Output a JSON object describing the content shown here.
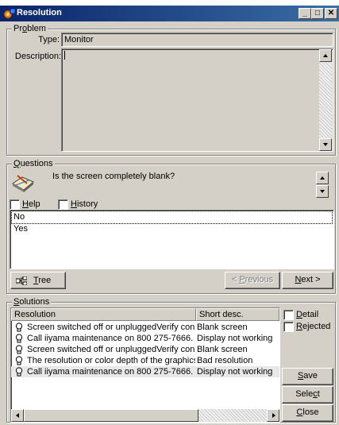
{
  "window": {
    "title": "Resolution",
    "min_glyph": "_",
    "max_glyph": "□",
    "close_glyph": "✕"
  },
  "problem": {
    "group_label_pre": "Pr",
    "group_label_ul": "o",
    "group_label_post": "blem",
    "type_label": "Type:",
    "type_value": "Monitor",
    "description_label": "Description:",
    "description_value": ""
  },
  "questions": {
    "group_label_ul": "Q",
    "group_label_post": "uestions",
    "question_text": "Is the screen completely blank?",
    "help_label_ul": "H",
    "help_label_post": "elp",
    "help_checked": false,
    "history_label_ul": "H",
    "history_label_post": "istory",
    "history_checked": false,
    "answers": [
      "No",
      "Yes"
    ],
    "selected_answer": "No",
    "tree_button_ul": "T",
    "tree_button_post": "ree",
    "previous_button_pre": "< ",
    "previous_button_ul": "P",
    "previous_button_post": "revious",
    "next_button_ul": "N",
    "next_button_post": "ext >"
  },
  "solutions": {
    "group_label_ul": "S",
    "group_label_post": "olutions",
    "columns": [
      "Resolution",
      "Short desc."
    ],
    "rows": [
      {
        "resolution": "Screen switched off or unpluggedVerify con...",
        "short_desc": "Blank screen"
      },
      {
        "resolution": "Call iiyama maintenance on 800 275-7666.",
        "short_desc": "Display not working"
      },
      {
        "resolution": "Screen switched off or unpluggedVerify con...",
        "short_desc": "Blank screen"
      },
      {
        "resolution": "The resolution or color depth of the graphics...",
        "short_desc": "Bad resolution"
      },
      {
        "resolution": "Call iiyama maintenance on 800 275-7666.",
        "short_desc": "Display not working"
      }
    ],
    "selected_row_index": 4,
    "detail_label_ul": "D",
    "detail_label_post": "etail",
    "detail_checked": false,
    "rejected_label_ul": "R",
    "rejected_label_post": "ejected",
    "rejected_checked": false,
    "save_button_ul": "S",
    "save_button_post": "ave",
    "select_button_pre": "Sele",
    "select_button_ul": "c",
    "select_button_post": "t",
    "close_button_ul": "C",
    "close_button_post": "lose"
  },
  "icons": {
    "app": "wizard-gear-icon",
    "question": "question-book-icon",
    "tree": "tree-view-icon",
    "solution": "lightbulb-icon"
  },
  "colors": {
    "titlebar_start": "#0a246a",
    "titlebar_end": "#3a6ea5",
    "face": "#d4d0c8"
  }
}
